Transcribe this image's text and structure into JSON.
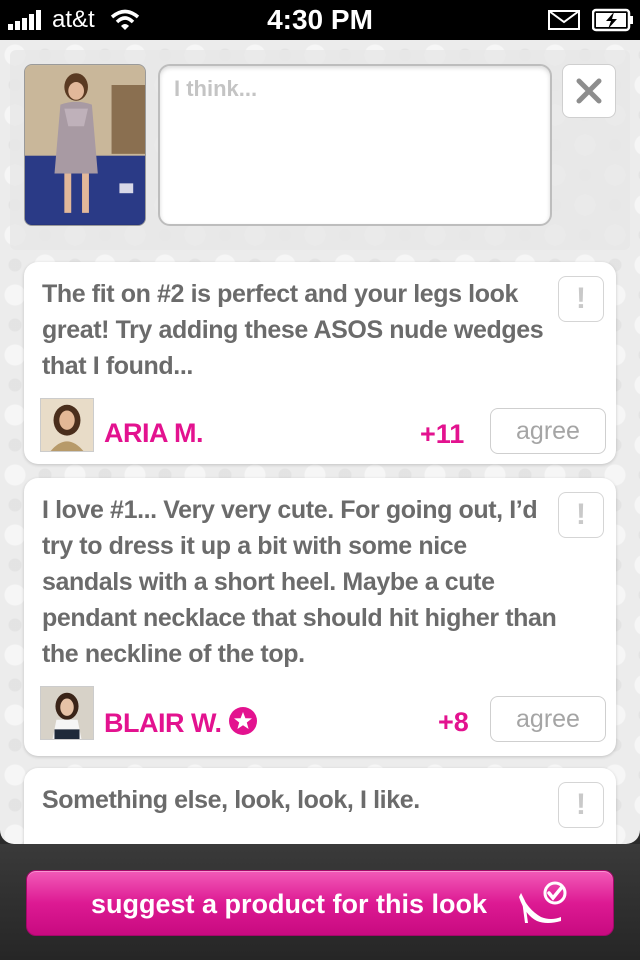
{
  "status_bar": {
    "carrier": "at&t",
    "time": "4:30 PM"
  },
  "compose": {
    "placeholder": "I think..."
  },
  "comments": [
    {
      "text": "The fit on #2 is perfect and your legs look great!  Try adding these ASOS nude wedges that I found...",
      "user": "ARIA M.",
      "votes": "+11",
      "agree_label": "agree",
      "flag_label": "!"
    },
    {
      "text": "I love #1... Very very cute.  For going out, I’d try to dress it up a bit with some nice sandals with a short heel.  Maybe a cute pendant necklace that should hit higher than the neckline of the top.",
      "user": "BLAIR W.",
      "votes": "+8",
      "agree_label": "agree",
      "flag_label": "!"
    },
    {
      "text": "Something else, look, look, I like.",
      "flag_label": "!"
    }
  ],
  "bottom": {
    "suggest_label": "suggest a product for this look"
  },
  "colors": {
    "accent": "#e3128f",
    "button_gradient_top": "#f25ab8",
    "button_gradient_bottom": "#c80a80"
  },
  "icons": {
    "signal": "signal-bars-icon",
    "wifi": "wifi-icon",
    "mail": "mail-icon",
    "battery": "battery-charging-icon",
    "close": "close-icon",
    "star": "star-badge-icon",
    "shoe": "high-heel-check-icon"
  }
}
